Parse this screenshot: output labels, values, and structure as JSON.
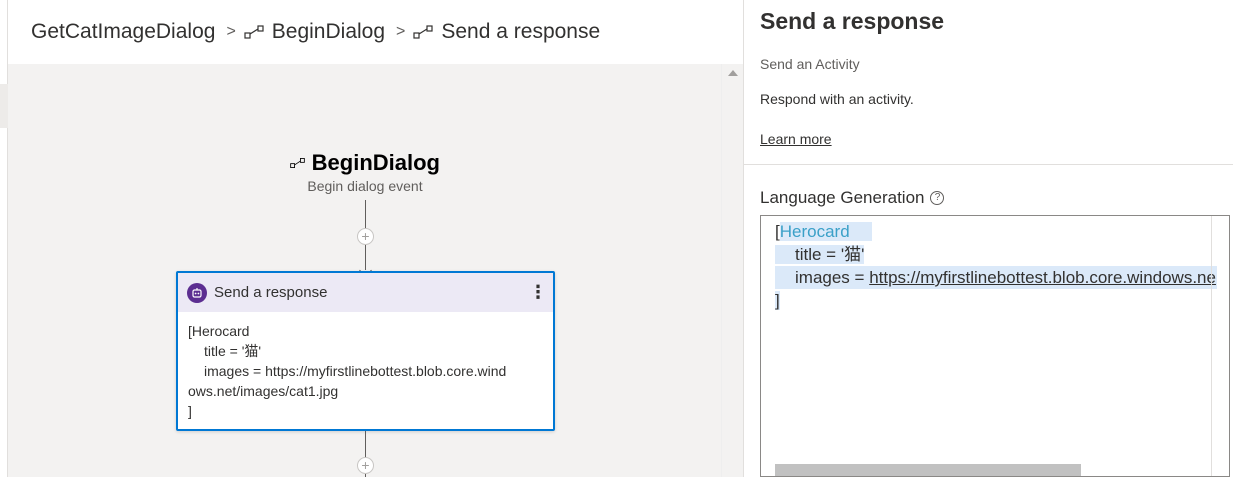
{
  "breadcrumb": {
    "items": [
      {
        "label": "GetCatImageDialog"
      },
      {
        "label": "BeginDialog"
      },
      {
        "label": "Send a response"
      }
    ],
    "separator": ">"
  },
  "canvas": {
    "trigger": {
      "title": "BeginDialog",
      "subtitle": "Begin dialog event"
    },
    "plus_glyph": "+",
    "card": {
      "title": "Send a response",
      "menu_glyph": "⋮",
      "body": {
        "line1": "[Herocard",
        "line2": "title = '猫'",
        "line3": "images = https://myfirstlinebottest.blob.core.wind",
        "line4": "ows.net/images/cat1.jpg",
        "line5": "]"
      }
    }
  },
  "panel": {
    "title": "Send a response",
    "kind": "Send an Activity",
    "description": "Respond with an activity.",
    "learn_more": "Learn more",
    "lg_label": "Language Generation",
    "help_glyph": "?",
    "editor": {
      "open_bracket": "[",
      "keyword": "Herocard",
      "line2": "title = '猫'",
      "line3_prefix": "images = ",
      "line3_link": "https://myfirstlinebottest.blob.core.windows.ne",
      "close_bracket": "]"
    }
  },
  "colors": {
    "accent": "#0078d4",
    "bot": "#5c2e91",
    "card_header": "#ece9f5",
    "canvas": "#f3f2f1",
    "keyword": "#3aa0c8",
    "selection": "#dbe9f9"
  },
  "icons": {
    "trigger": "trigger-node-icon",
    "bot": "bot-icon",
    "help": "help-circle-icon"
  }
}
